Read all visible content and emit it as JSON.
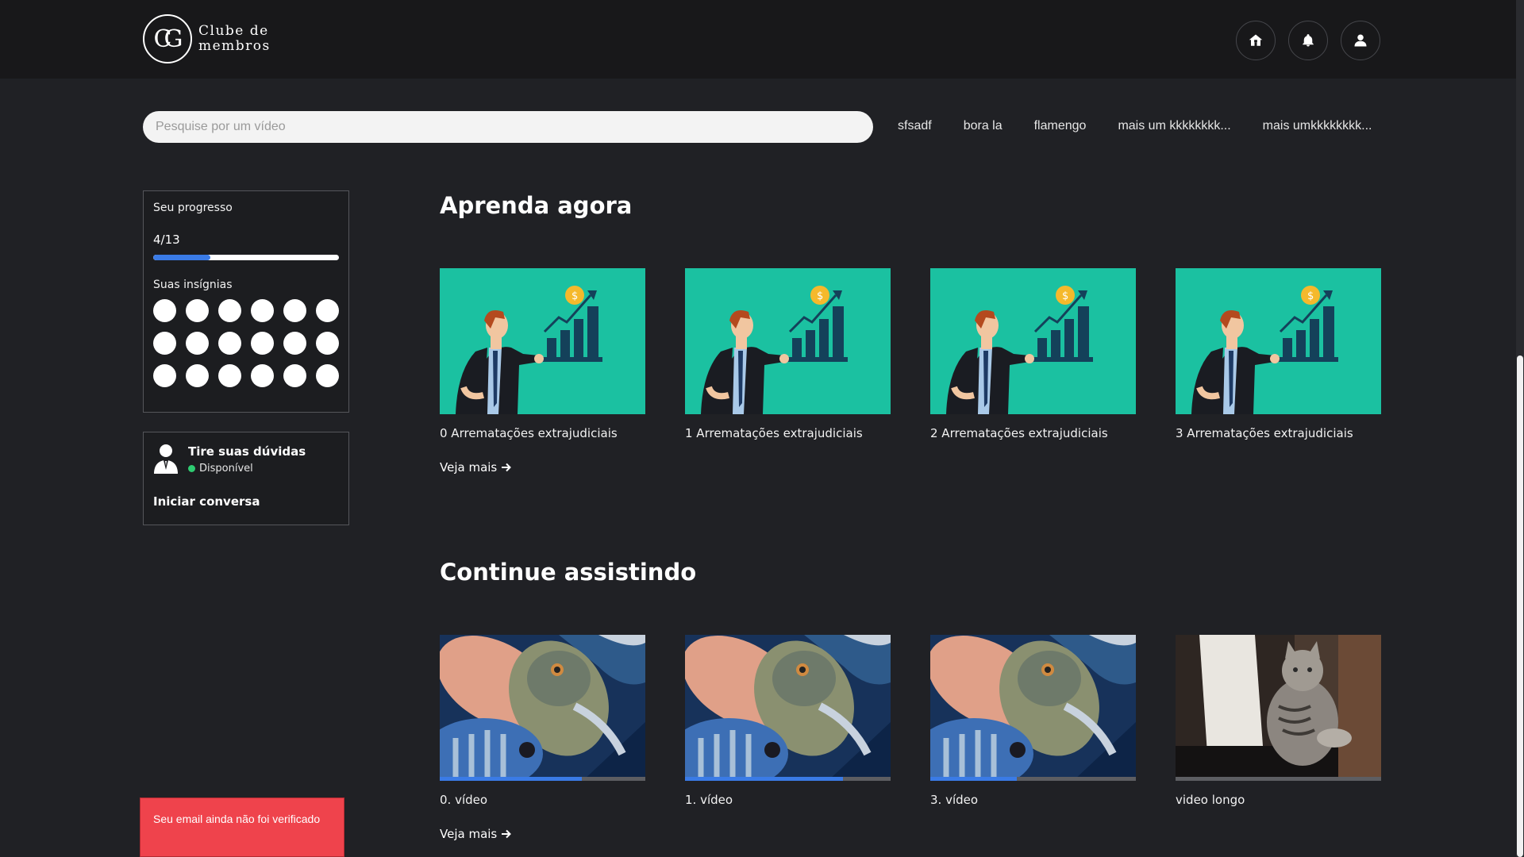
{
  "header": {
    "logo_mark": "CG",
    "logo_text": "Clube de membros",
    "buttons": [
      {
        "icon": "home-icon"
      },
      {
        "icon": "bell-icon"
      },
      {
        "icon": "user-icon"
      }
    ]
  },
  "search": {
    "placeholder": "Pesquise por um vídeo",
    "value": ""
  },
  "tags": [
    "sfsadf",
    "bora la",
    "flamengo",
    "mais um kkkkkkkk...",
    "mais umkkkkkkkk..."
  ],
  "progress": {
    "title": "Seu progresso",
    "count_label": "4/13",
    "completed": 4,
    "total": 13,
    "badges_label": "Suas insígnias",
    "badge_count": 18
  },
  "help": {
    "title": "Tire suas dúvidas",
    "status": "Disponível",
    "status_color": "#2ecc71",
    "action": "Iniciar conversa"
  },
  "sections": [
    {
      "title": "Aprenda agora",
      "see_more": "Veja mais",
      "cards": [
        {
          "title": "0 Arrematações extrajudiciais",
          "thumb": "business-chart"
        },
        {
          "title": "1 Arrematações extrajudiciais",
          "thumb": "business-chart"
        },
        {
          "title": "2 Arrematações extrajudiciais",
          "thumb": "business-chart"
        },
        {
          "title": "3 Arrematações extrajudiciais",
          "thumb": "business-chart"
        }
      ]
    },
    {
      "title": "Continue assistindo",
      "see_more": "Veja mais",
      "cards": [
        {
          "title": "0. vídeo",
          "thumb": "fish",
          "progress": 0.69
        },
        {
          "title": "1. vídeo",
          "thumb": "fish",
          "progress": 0.77
        },
        {
          "title": "3. vídeo",
          "thumb": "fish",
          "progress": 0.42
        },
        {
          "title": "video longo",
          "thumb": "cat",
          "progress": 0.0
        }
      ]
    }
  ],
  "toast": {
    "message": "Seu email ainda não foi verificado",
    "color": "#ef434c"
  },
  "colors": {
    "background": "#202125",
    "topbar": "#18181a",
    "accent": "#3a7be6",
    "thumb_green": "#1bc1a1"
  }
}
